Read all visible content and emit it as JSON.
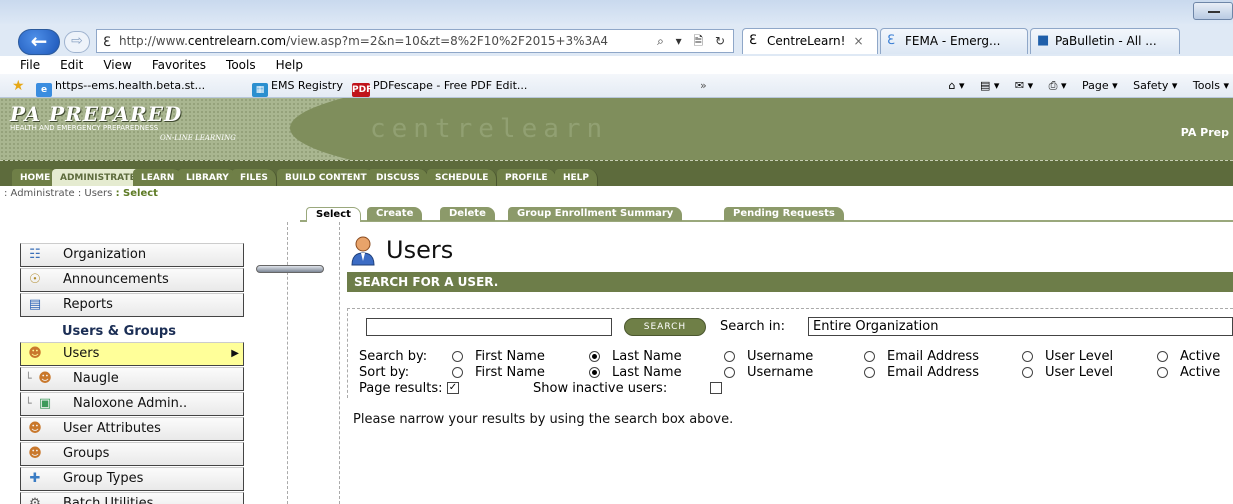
{
  "browser": {
    "url_prefix": "http://www.",
    "url_domain": "centrelearn.com",
    "url_path": "/view.asp?m=2&n=10&zt=8%2F10%2F2015+3%3A4",
    "addr_tools": "⌕ ▾ 🗎 ↻",
    "tabs": [
      {
        "label": "CentreLearn!",
        "icon": "ie-icon"
      },
      {
        "label": "FEMA - Emerg...",
        "icon": "ie-icon"
      },
      {
        "label": "PaBulletin - All ...",
        "icon": "pabulletin-icon"
      }
    ],
    "menu": [
      "File",
      "Edit",
      "View",
      "Favorites",
      "Tools",
      "Help"
    ],
    "favorites": [
      {
        "label": "https--ems.health.beta.st...",
        "icon": "ie-page-icon"
      },
      {
        "label": "EMS Registry",
        "icon": "registry-icon"
      },
      {
        "label": "PDFescape - Free PDF Edit...",
        "icon": "pdf-icon",
        "badge": "PDF"
      }
    ],
    "command_bar": [
      "Page ▾",
      "Safety ▾",
      "Tools ▾"
    ]
  },
  "site": {
    "logo_main": "PA PREPARED",
    "logo_sub": "HEALTH AND EMERGENCY PREPAREDNESS",
    "logo_sub2": "ON-LINE LEARNING",
    "brand": "centrelearn",
    "right_text": "PA Prep"
  },
  "nav": {
    "tabs": [
      "HOME",
      "ADMINISTRATE",
      "LEARN",
      "LIBRARY",
      "FILES",
      "BUILD CONTENT",
      "DISCUSS",
      "SCHEDULE",
      "PROFILE",
      "HELP"
    ],
    "active": "ADMINISTRATE"
  },
  "breadcrumb": {
    "part1": ": Administrate",
    "part2": ": Users",
    "current": ": Select"
  },
  "subtabs": [
    "Select",
    "Create",
    "Delete",
    "Group Enrollment Summary",
    "Pending Requests"
  ],
  "sidebar": {
    "items": [
      {
        "label": "Organization",
        "icon": "organization-icon"
      },
      {
        "label": "Announcements",
        "icon": "microphone-icon"
      },
      {
        "label": "Reports",
        "icon": "reports-icon"
      },
      {
        "label": "Users",
        "icon": "user-icon"
      },
      {
        "label": "Naugle",
        "icon": "user-icon"
      },
      {
        "label": "Naloxone Admin..",
        "icon": "admin-icon"
      },
      {
        "label": "User Attributes",
        "icon": "user-attributes-icon"
      },
      {
        "label": "Groups",
        "icon": "groups-icon"
      },
      {
        "label": "Group Types",
        "icon": "group-types-icon"
      },
      {
        "label": "Batch Utilities",
        "icon": "batch-icon"
      }
    ],
    "heading": "Users & Groups",
    "active": "Users"
  },
  "main": {
    "title": "Users",
    "section": "SEARCH FOR A USER.",
    "search_value": "",
    "search_button": "SEARCH",
    "search_in_label": "Search in:",
    "search_in_value": "Entire Organization",
    "search_by_label": "Search by:",
    "sort_by_label": "Sort by:",
    "fields": [
      "First Name",
      "Last Name",
      "Username",
      "Email Address",
      "User Level",
      "Active"
    ],
    "search_by_selected": "Last Name",
    "sort_by_selected": "Last Name",
    "page_results_label": "Page results:",
    "page_results_checked": true,
    "show_inactive_label": "Show inactive users:",
    "show_inactive_checked": false,
    "hint": "Please narrow your results by using the search box above."
  }
}
